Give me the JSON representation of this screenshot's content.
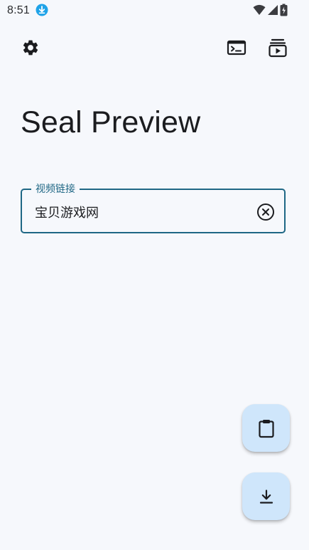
{
  "status_bar": {
    "time": "8:51",
    "icons": [
      "download-notification-icon",
      "wifi-icon",
      "cell-signal-icon",
      "battery-charging-icon"
    ]
  },
  "app_bar": {
    "icons": [
      "settings-icon",
      "terminal-icon",
      "download-queue-icon"
    ]
  },
  "main": {
    "title": "Seal Preview",
    "url_field": {
      "label": "视频链接",
      "value": "宝贝游戏网"
    }
  },
  "fabs": {
    "paste_icon": "clipboard-icon",
    "download_icon": "download-icon"
  },
  "colors": {
    "background": "#f6f8fc",
    "accent": "#1f6785",
    "fab_container": "#cfe6fb",
    "notification_blue": "#1fa3e8",
    "on_surface": "#1b1c1f"
  }
}
